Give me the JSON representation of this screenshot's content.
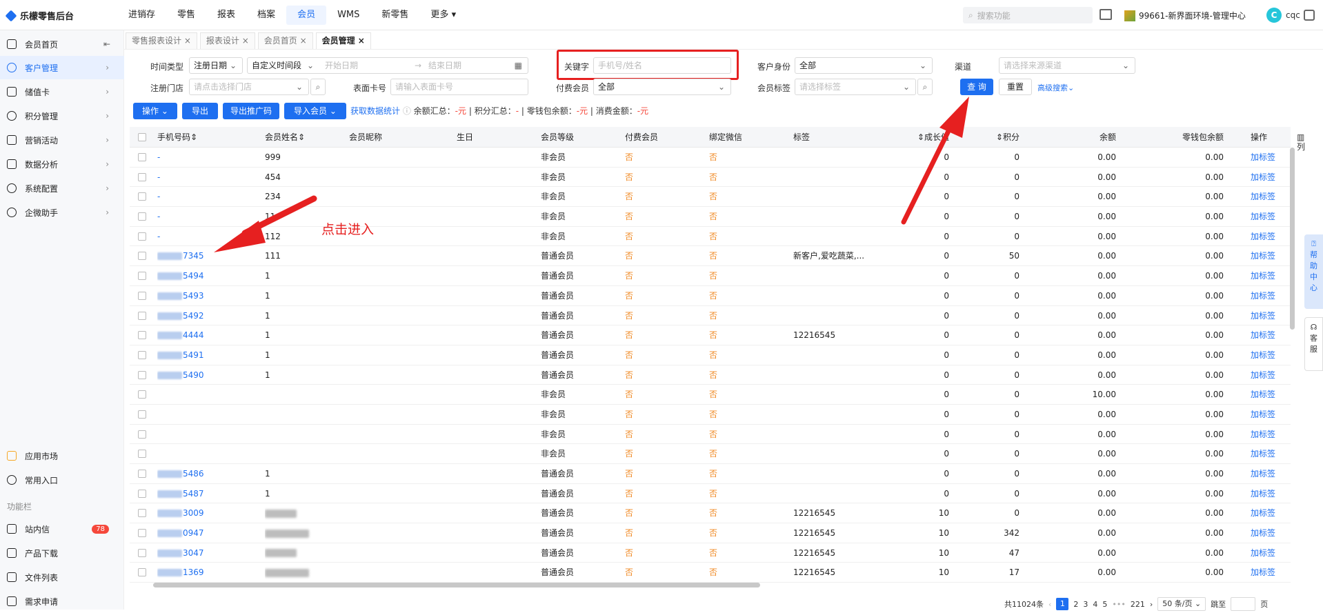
{
  "app": {
    "name": "乐檬零售后台"
  },
  "topnav": [
    "进销存",
    "零售",
    "报表",
    "档案",
    "会员",
    "WMS",
    "新零售",
    "更多"
  ],
  "topnav_active": "会员",
  "search": {
    "placeholder": "搜索功能"
  },
  "org": {
    "name": "99661-新界面环境-管理中心"
  },
  "user": {
    "initial": "C",
    "name": "cqc"
  },
  "sidebar": {
    "items": [
      {
        "label": "会员首页"
      },
      {
        "label": "客户管理"
      },
      {
        "label": "储值卡"
      },
      {
        "label": "积分管理"
      },
      {
        "label": "营销活动"
      },
      {
        "label": "数据分析"
      },
      {
        "label": "系统配置"
      },
      {
        "label": "企微助手"
      }
    ],
    "bottom": [
      {
        "label": "应用市场"
      },
      {
        "label": "常用入口"
      }
    ],
    "section_label": "功能栏",
    "func": [
      {
        "label": "站内信",
        "badge": "78"
      },
      {
        "label": "产品下载"
      },
      {
        "label": "文件列表"
      },
      {
        "label": "需求申请"
      }
    ]
  },
  "tabs": [
    "零售报表设计 ×",
    "报表设计 ×",
    "会员首页 ×",
    "会员管理 ×"
  ],
  "filter": {
    "time_type_label": "时间类型",
    "time_type_value": "注册日期",
    "time_range_value": "自定义时间段",
    "start_ph": "开始日期",
    "end_ph": "结束日期",
    "keyword_label": "关键字",
    "keyword_ph": "手机号/姓名",
    "identity_label": "客户身份",
    "identity_value": "全部",
    "channel_label": "渠道",
    "channel_ph": "请选择来源渠道",
    "store_label": "注册门店",
    "store_ph": "请点击选择门店",
    "card_label": "表面卡号",
    "card_ph": "请输入表面卡号",
    "paid_label": "付费会员",
    "paid_value": "全部",
    "tag_label": "会员标签",
    "tag_ph": "请选择标签",
    "query_btn": "查 询",
    "reset_btn": "重置",
    "advanced": "高级搜索"
  },
  "actions": {
    "op": "操作",
    "export": "导出",
    "export_promo": "导出推广码",
    "import": "导入会员",
    "fetch_stats": "获取数据统计",
    "s1": "余额汇总：",
    "v1": "-元",
    "s2": " | 积分汇总：",
    "v2": "-",
    "s3": " | 零钱包余额：",
    "v3": "-元",
    "s4": " | 消费金额：",
    "v4": "-元"
  },
  "table": {
    "headers": [
      "手机号码",
      "会员姓名",
      "会员昵称",
      "生日",
      "会员等级",
      "付费会员",
      "绑定微信",
      "标签",
      "成长值",
      "积分",
      "余额",
      "零钱包余额",
      "操作"
    ],
    "rows": [
      {
        "phone": "-",
        "name": "999",
        "level": "非会员",
        "paid": "否",
        "wx": "否",
        "tag": "",
        "growth": "0",
        "points": "0",
        "balance": "0.00",
        "wallet": "0.00",
        "op": "加标签"
      },
      {
        "phone": "-",
        "name": "454",
        "level": "非会员",
        "paid": "否",
        "wx": "否",
        "tag": "",
        "growth": "0",
        "points": "0",
        "balance": "0.00",
        "wallet": "0.00",
        "op": "加标签"
      },
      {
        "phone": "-",
        "name": "234",
        "level": "非会员",
        "paid": "否",
        "wx": "否",
        "tag": "",
        "growth": "0",
        "points": "0",
        "balance": "0.00",
        "wallet": "0.00",
        "op": "加标签"
      },
      {
        "phone": "-",
        "name": "11",
        "level": "非会员",
        "paid": "否",
        "wx": "否",
        "tag": "",
        "growth": "0",
        "points": "0",
        "balance": "0.00",
        "wallet": "0.00",
        "op": "加标签"
      },
      {
        "phone": "-",
        "name": "112",
        "level": "非会员",
        "paid": "否",
        "wx": "否",
        "tag": "",
        "growth": "0",
        "points": "0",
        "balance": "0.00",
        "wallet": "0.00",
        "op": "加标签"
      },
      {
        "phone": "7345",
        "name": "111",
        "level": "普通会员",
        "paid": "否",
        "wx": "否",
        "tag": "新客户,爱吃蔬菜,...",
        "growth": "0",
        "points": "50",
        "balance": "0.00",
        "wallet": "0.00",
        "op": "加标签"
      },
      {
        "phone": "5494",
        "name": "1",
        "level": "普通会员",
        "paid": "否",
        "wx": "否",
        "tag": "",
        "growth": "0",
        "points": "0",
        "balance": "0.00",
        "wallet": "0.00",
        "op": "加标签"
      },
      {
        "phone": "5493",
        "name": "1",
        "level": "普通会员",
        "paid": "否",
        "wx": "否",
        "tag": "",
        "growth": "0",
        "points": "0",
        "balance": "0.00",
        "wallet": "0.00",
        "op": "加标签"
      },
      {
        "phone": "5492",
        "name": "1",
        "level": "普通会员",
        "paid": "否",
        "wx": "否",
        "tag": "",
        "growth": "0",
        "points": "0",
        "balance": "0.00",
        "wallet": "0.00",
        "op": "加标签"
      },
      {
        "phone": "4444",
        "name": "1",
        "level": "普通会员",
        "paid": "否",
        "wx": "否",
        "tag": "12216545",
        "growth": "0",
        "points": "0",
        "balance": "0.00",
        "wallet": "0.00",
        "op": "加标签"
      },
      {
        "phone": "5491",
        "name": "1",
        "level": "普通会员",
        "paid": "否",
        "wx": "否",
        "tag": "",
        "growth": "0",
        "points": "0",
        "balance": "0.00",
        "wallet": "0.00",
        "op": "加标签"
      },
      {
        "phone": "5490",
        "name": "1",
        "level": "普通会员",
        "paid": "否",
        "wx": "否",
        "tag": "",
        "growth": "0",
        "points": "0",
        "balance": "0.00",
        "wallet": "0.00",
        "op": "加标签"
      },
      {
        "phone": "",
        "name": "",
        "level": "非会员",
        "paid": "否",
        "wx": "否",
        "tag": "",
        "growth": "0",
        "points": "0",
        "balance": "10.00",
        "wallet": "0.00",
        "op": "加标签"
      },
      {
        "phone": "",
        "name": "",
        "level": "非会员",
        "paid": "否",
        "wx": "否",
        "tag": "",
        "growth": "0",
        "points": "0",
        "balance": "0.00",
        "wallet": "0.00",
        "op": "加标签"
      },
      {
        "phone": "",
        "name": "",
        "level": "非会员",
        "paid": "否",
        "wx": "否",
        "tag": "",
        "growth": "0",
        "points": "0",
        "balance": "0.00",
        "wallet": "0.00",
        "op": "加标签"
      },
      {
        "phone": "",
        "name": "",
        "level": "非会员",
        "paid": "否",
        "wx": "否",
        "tag": "",
        "growth": "0",
        "points": "0",
        "balance": "0.00",
        "wallet": "0.00",
        "op": "加标签"
      },
      {
        "phone": "5486",
        "name": "1",
        "level": "普通会员",
        "paid": "否",
        "wx": "否",
        "tag": "",
        "growth": "0",
        "points": "0",
        "balance": "0.00",
        "wallet": "0.00",
        "op": "加标签"
      },
      {
        "phone": "5487",
        "name": "1",
        "level": "普通会员",
        "paid": "否",
        "wx": "否",
        "tag": "",
        "growth": "0",
        "points": "0",
        "balance": "0.00",
        "wallet": "0.00",
        "op": "加标签"
      },
      {
        "phone": "3009",
        "name": "",
        "level": "普通会员",
        "paid": "否",
        "wx": "否",
        "tag": "12216545",
        "growth": "10",
        "points": "0",
        "balance": "0.00",
        "wallet": "0.00",
        "op": "加标签"
      },
      {
        "phone": "0947",
        "name": "",
        "level": "普通会员",
        "paid": "否",
        "wx": "否",
        "tag": "12216545",
        "growth": "10",
        "points": "342",
        "balance": "0.00",
        "wallet": "0.00",
        "op": "加标签"
      },
      {
        "phone": "3047",
        "name": "",
        "level": "普通会员",
        "paid": "否",
        "wx": "否",
        "tag": "12216545",
        "growth": "10",
        "points": "47",
        "balance": "0.00",
        "wallet": "0.00",
        "op": "加标签"
      },
      {
        "phone": "1369",
        "name": "",
        "level": "普通会员",
        "paid": "否",
        "wx": "否",
        "tag": "12216545",
        "growth": "10",
        "points": "17",
        "balance": "0.00",
        "wallet": "0.00",
        "op": "加标签"
      }
    ]
  },
  "column_setting": "列",
  "help": "帮助中心",
  "service": "客服",
  "annotation": "点击进入",
  "pager": {
    "total": "共11024条",
    "pages": [
      "1",
      "2",
      "3",
      "4",
      "5",
      "•••",
      "221"
    ],
    "size": "50 条/页",
    "jump": "跳至",
    "page_unit": "页"
  }
}
